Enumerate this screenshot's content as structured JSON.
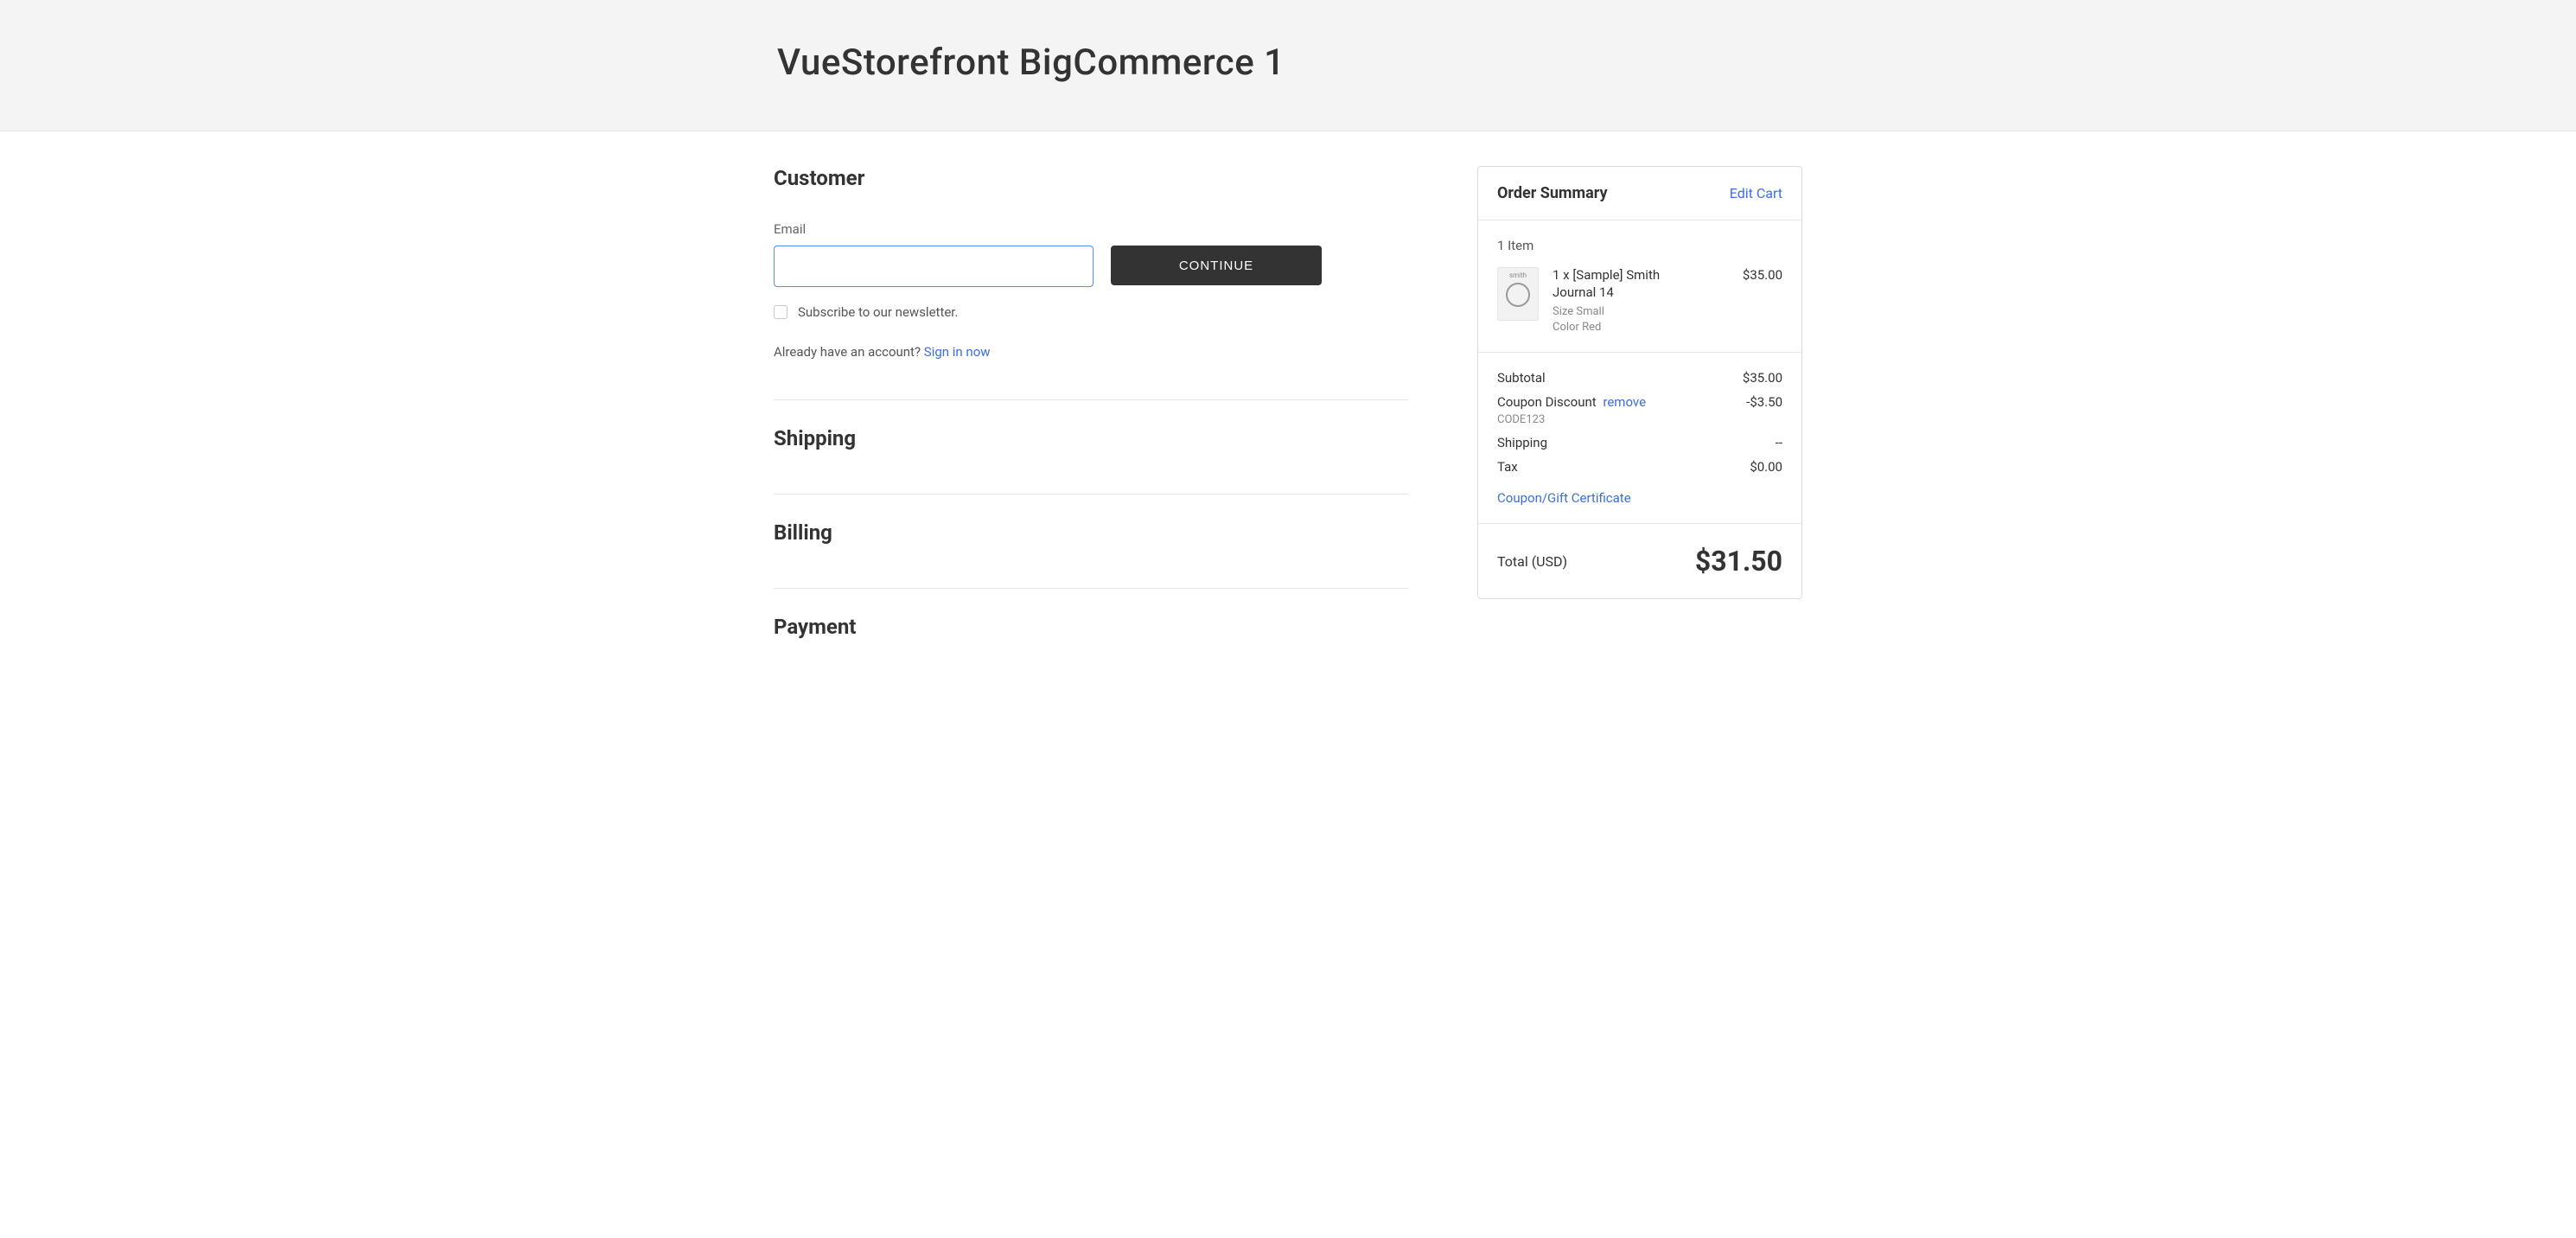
{
  "header": {
    "site_title": "VueStorefront BigCommerce 1"
  },
  "customer": {
    "heading": "Customer",
    "email_label": "Email",
    "email_value": "",
    "continue_label": "CONTINUE",
    "subscribe_label": "Subscribe to our newsletter.",
    "signin_prompt": "Already have an account? ",
    "signin_link": "Sign in now"
  },
  "shipping": {
    "heading": "Shipping"
  },
  "billing": {
    "heading": "Billing"
  },
  "payment": {
    "heading": "Payment"
  },
  "summary": {
    "title": "Order Summary",
    "edit_cart": "Edit Cart",
    "item_count": "1 Item",
    "items": [
      {
        "thumb_word": "smith",
        "qty_name": "1 x [Sample] Smith Journal 14",
        "attr1": "Size Small",
        "attr2": "Color Red",
        "price": "$35.00"
      }
    ],
    "subtotal_label": "Subtotal",
    "subtotal_value": "$35.00",
    "coupon_label": "Coupon Discount",
    "coupon_remove": "remove",
    "coupon_code": "CODE123",
    "coupon_value": "-$3.50",
    "shipping_label": "Shipping",
    "shipping_value": "--",
    "tax_label": "Tax",
    "tax_value": "$0.00",
    "coupon_link": "Coupon/Gift Certificate",
    "total_label": "Total (USD)",
    "total_value": "$31.50"
  }
}
